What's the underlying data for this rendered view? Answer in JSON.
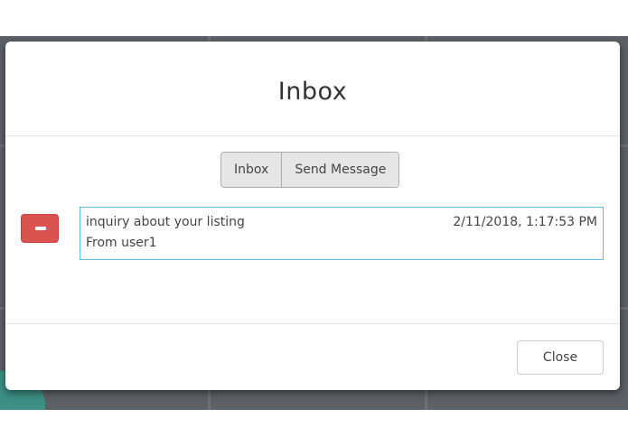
{
  "modal": {
    "title": "Inbox"
  },
  "tabs": [
    {
      "label": "Inbox"
    },
    {
      "label": "Send Message"
    }
  ],
  "messages": [
    {
      "subject": "inquiry about your listing",
      "date": "2/11/2018, 1:17:53 PM",
      "from": "From user1"
    }
  ],
  "footer": {
    "close_label": "Close"
  },
  "colors": {
    "delete": "#d9534f",
    "selected_border": "#5bc0de"
  },
  "icons": {
    "delete": "minus-icon"
  }
}
